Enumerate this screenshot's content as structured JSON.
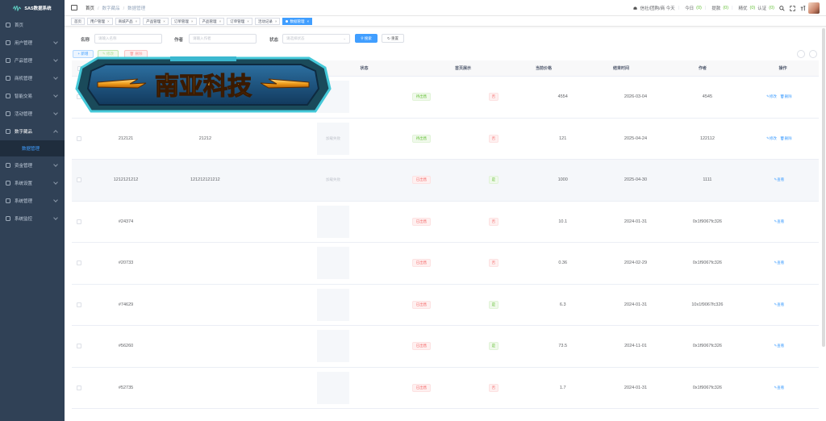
{
  "sidebar": {
    "logo_text": "SAS数据系统",
    "items": [
      {
        "label": "首页",
        "icon": "home-icon"
      },
      {
        "label": "用户管理",
        "icon": "user-icon"
      },
      {
        "label": "产品管理",
        "icon": "product-icon"
      },
      {
        "label": "商机管理",
        "icon": "opportunity-icon"
      },
      {
        "label": "智能交易",
        "icon": "trade-icon"
      },
      {
        "label": "活动管理",
        "icon": "activity-icon"
      },
      {
        "label": "数字藏品",
        "icon": "chart-icon",
        "open": true
      },
      {
        "label": "数据管理",
        "sub": true
      },
      {
        "label": "资金管理",
        "icon": "fund-icon"
      },
      {
        "label": "系统设置",
        "icon": "settings-icon"
      },
      {
        "label": "系统管理",
        "icon": "gear-icon"
      },
      {
        "label": "系统监控",
        "icon": "monitor-icon"
      }
    ]
  },
  "navbar": {
    "breadcrumb": [
      "首页",
      "数字藏品",
      "数据管理"
    ],
    "notice_label": "信社/团购/商 今天",
    "today_label": "今日",
    "today_count": "(0)",
    "stat1_label": "提款",
    "stat1_count": "(0)",
    "stat2_label": "精优",
    "stat2_count": "(0)",
    "stat3_label": "认证",
    "stat3_count": "(0)"
  },
  "tags": [
    {
      "label": "首页"
    },
    {
      "label": "用户管理"
    },
    {
      "label": "商城产品"
    },
    {
      "label": "产品管理"
    },
    {
      "label": "订单管理"
    },
    {
      "label": "产品管理"
    },
    {
      "label": "订单管理"
    },
    {
      "label": "活动记录"
    },
    {
      "label": "数据管理",
      "active": true
    }
  ],
  "search": {
    "name_label": "名称",
    "name_placeholder": "请输入名称",
    "author_label": "作者",
    "author_placeholder": "请输入作者",
    "status_label": "状态",
    "status_placeholder": "请选择状态",
    "search_btn": "搜索",
    "reset_btn": "重置"
  },
  "toolbar": {
    "add": "+ 新增",
    "edit": "修改",
    "delete": "删除"
  },
  "banner_text": "南亚科技",
  "table": {
    "headers": [
      "",
      "",
      "",
      "",
      "状态",
      "首页展示",
      "当前价格",
      "结束时间",
      "作者",
      "操作"
    ],
    "rows": [
      {
        "c1": "",
        "c2": "",
        "img": "",
        "status": "待出售",
        "status_type": "on",
        "show": "否",
        "show_type": "no",
        "price": "4554",
        "date": "2026-03-04",
        "author": "4545",
        "ops": [
          "修改",
          "删除"
        ],
        "hl": false
      },
      {
        "c1": "212121",
        "c2": "21212",
        "img": "加载失败",
        "status": "待出售",
        "status_type": "on",
        "show": "否",
        "show_type": "no",
        "price": "121",
        "date": "2025-04-24",
        "author": "122112",
        "ops": [
          "修改",
          "删除"
        ],
        "hl": false
      },
      {
        "c1": "1212121212",
        "c2": "121212121212",
        "img": "加载失败",
        "status": "已出售",
        "status_type": "off",
        "show": "是",
        "show_type": "yes",
        "price": "1000",
        "date": "2025-04-30",
        "author": "1111",
        "ops": [
          "查看"
        ],
        "hl": true
      },
      {
        "c1": "#24374",
        "c2": "",
        "img": "",
        "status": "已出售",
        "status_type": "off",
        "show": "否",
        "show_type": "no",
        "price": "10.1",
        "date": "2024-01-31",
        "author": "0x1f9067fc326",
        "ops": [
          "查看"
        ],
        "hl": false
      },
      {
        "c1": "#20733",
        "c2": "",
        "img": "",
        "status": "已出售",
        "status_type": "off",
        "show": "否",
        "show_type": "no",
        "price": "0.36",
        "date": "2024-02-29",
        "author": "0x1f9067fc326",
        "ops": [
          "查看"
        ],
        "hl": false
      },
      {
        "c1": "#74629",
        "c2": "",
        "img": "",
        "status": "已出售",
        "status_type": "off",
        "show": "是",
        "show_type": "yes",
        "price": "6.3",
        "date": "2024-01-31",
        "author": "10x1f9067fc326",
        "ops": [
          "查看"
        ],
        "hl": false
      },
      {
        "c1": "#56260",
        "c2": "",
        "img": "",
        "status": "已出售",
        "status_type": "off",
        "show": "是",
        "show_type": "yes",
        "price": "73.5",
        "date": "2024-11-01",
        "author": "0x1f9067fc326",
        "ops": [
          "查看"
        ],
        "hl": false
      },
      {
        "c1": "#52735",
        "c2": "",
        "img": "",
        "status": "已出售",
        "status_type": "off",
        "show": "否",
        "show_type": "no",
        "price": "1.7",
        "date": "2024-01-31",
        "author": "0x1f9067fc326",
        "ops": [
          "查看"
        ],
        "hl": false
      }
    ]
  },
  "colors": {
    "sidebar_bg": "#304156",
    "primary": "#409eff",
    "success": "#67c23a",
    "danger": "#f56c6c"
  }
}
